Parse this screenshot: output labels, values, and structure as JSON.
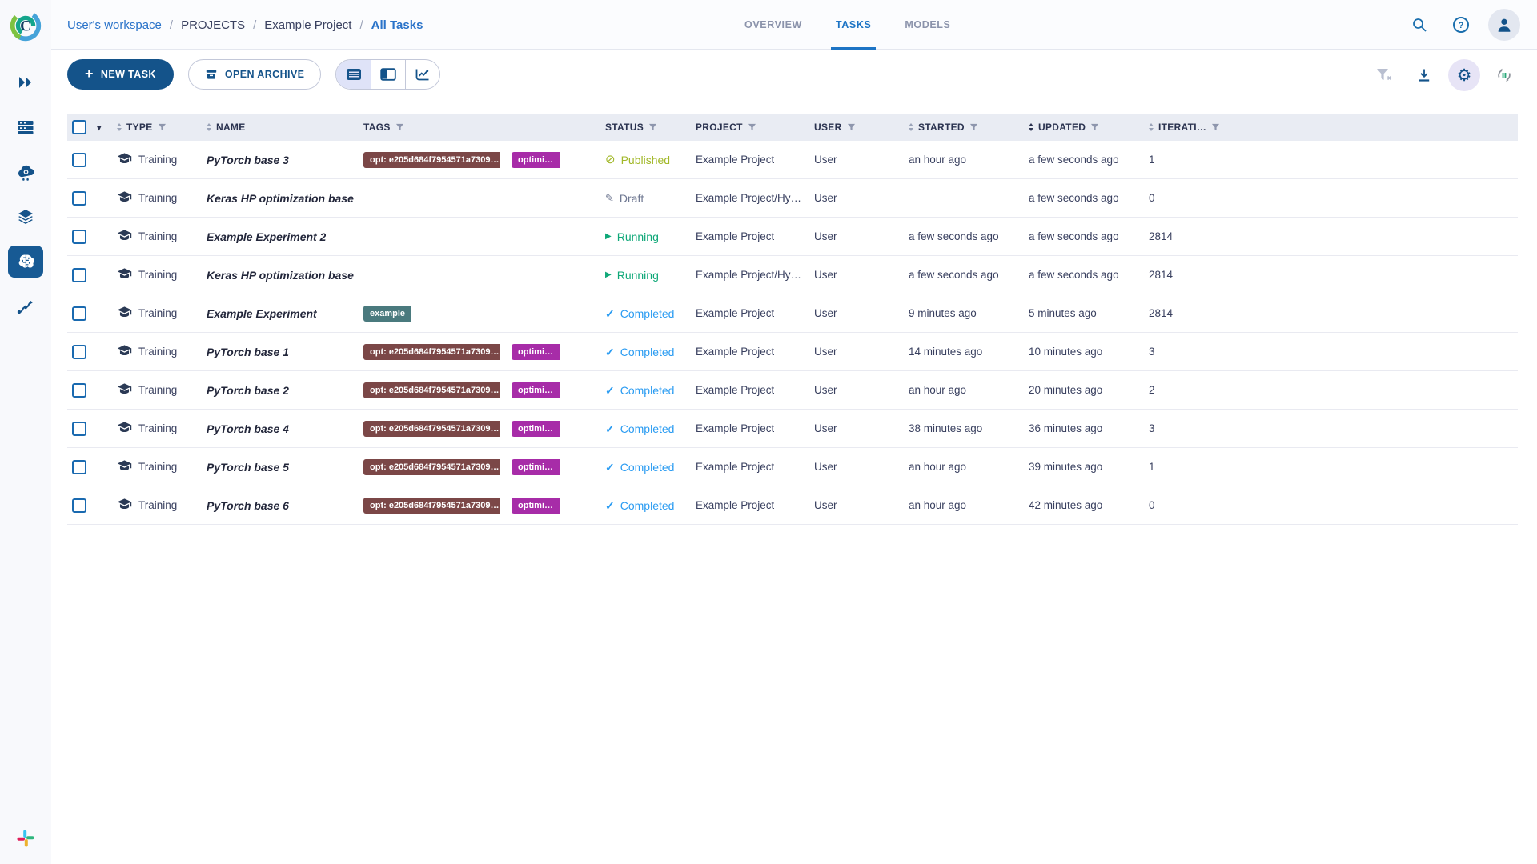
{
  "header": {
    "breadcrumb": [
      {
        "label": "User's workspace"
      },
      {
        "label": "PROJECTS"
      },
      {
        "label": "Example Project"
      },
      {
        "label": "All Tasks"
      }
    ],
    "breadcrumb_separator": "/",
    "tabs": [
      {
        "label": "OVERVIEW",
        "active": false
      },
      {
        "label": "TASKS",
        "active": true
      },
      {
        "label": "MODELS",
        "active": false
      }
    ]
  },
  "toolbar": {
    "new_task_label": "NEW TASK",
    "open_archive_label": "OPEN ARCHIVE"
  },
  "table": {
    "columns": [
      {
        "key": "type",
        "label": "TYPE"
      },
      {
        "key": "name",
        "label": "NAME"
      },
      {
        "key": "tags",
        "label": "TAGS"
      },
      {
        "key": "status",
        "label": "STATUS"
      },
      {
        "key": "project",
        "label": "PROJECT"
      },
      {
        "key": "user",
        "label": "USER"
      },
      {
        "key": "started",
        "label": "STARTED"
      },
      {
        "key": "updated",
        "label": "UPDATED"
      },
      {
        "key": "iterations",
        "label": "ITERATI…"
      }
    ],
    "rows": [
      {
        "type": "Training",
        "name": "PyTorch base 3",
        "tags": [
          {
            "text": "opt: e205d684f7954571a7309…",
            "color": "maroon"
          },
          {
            "text": "optimi…",
            "color": "magenta"
          }
        ],
        "status": {
          "label": "Published",
          "kind": "published"
        },
        "project": "Example Project",
        "user": "User",
        "started": "an hour ago",
        "updated": "a few seconds ago",
        "iterations": "1"
      },
      {
        "type": "Training",
        "name": "Keras HP optimization base",
        "tags": [],
        "status": {
          "label": "Draft",
          "kind": "draft"
        },
        "project": "Example Project/Hy…",
        "user": "User",
        "started": "",
        "updated": "a few seconds ago",
        "iterations": "0"
      },
      {
        "type": "Training",
        "name": "Example Experiment 2",
        "tags": [],
        "status": {
          "label": "Running",
          "kind": "running"
        },
        "project": "Example Project",
        "user": "User",
        "started": "a few seconds ago",
        "updated": "a few seconds ago",
        "iterations": "2814"
      },
      {
        "type": "Training",
        "name": "Keras HP optimization base",
        "tags": [],
        "status": {
          "label": "Running",
          "kind": "running"
        },
        "project": "Example Project/Hy…",
        "user": "User",
        "started": "a few seconds ago",
        "updated": "a few seconds ago",
        "iterations": "2814"
      },
      {
        "type": "Training",
        "name": "Example Experiment",
        "tags": [
          {
            "text": "example",
            "color": "teal"
          }
        ],
        "status": {
          "label": "Completed",
          "kind": "completed"
        },
        "project": "Example Project",
        "user": "User",
        "started": "9 minutes ago",
        "updated": "5 minutes ago",
        "iterations": "2814"
      },
      {
        "type": "Training",
        "name": "PyTorch base 1",
        "tags": [
          {
            "text": "opt: e205d684f7954571a7309…",
            "color": "maroon"
          },
          {
            "text": "optimi…",
            "color": "magenta"
          }
        ],
        "status": {
          "label": "Completed",
          "kind": "completed"
        },
        "project": "Example Project",
        "user": "User",
        "started": "14 minutes ago",
        "updated": "10 minutes ago",
        "iterations": "3"
      },
      {
        "type": "Training",
        "name": "PyTorch base 2",
        "tags": [
          {
            "text": "opt: e205d684f7954571a7309…",
            "color": "maroon"
          },
          {
            "text": "optimi…",
            "color": "magenta"
          }
        ],
        "status": {
          "label": "Completed",
          "kind": "completed"
        },
        "project": "Example Project",
        "user": "User",
        "started": "an hour ago",
        "updated": "20 minutes ago",
        "iterations": "2"
      },
      {
        "type": "Training",
        "name": "PyTorch base 4",
        "tags": [
          {
            "text": "opt: e205d684f7954571a7309…",
            "color": "maroon"
          },
          {
            "text": "optimi…",
            "color": "magenta"
          }
        ],
        "status": {
          "label": "Completed",
          "kind": "completed"
        },
        "project": "Example Project",
        "user": "User",
        "started": "38 minutes ago",
        "updated": "36 minutes ago",
        "iterations": "3"
      },
      {
        "type": "Training",
        "name": "PyTorch base 5",
        "tags": [
          {
            "text": "opt: e205d684f7954571a7309…",
            "color": "maroon"
          },
          {
            "text": "optimi…",
            "color": "magenta"
          }
        ],
        "status": {
          "label": "Completed",
          "kind": "completed"
        },
        "project": "Example Project",
        "user": "User",
        "started": "an hour ago",
        "updated": "39 minutes ago",
        "iterations": "1"
      },
      {
        "type": "Training",
        "name": "PyTorch base 6",
        "tags": [
          {
            "text": "opt: e205d684f7954571a7309…",
            "color": "maroon"
          },
          {
            "text": "optimi…",
            "color": "magenta"
          }
        ],
        "status": {
          "label": "Completed",
          "kind": "completed"
        },
        "project": "Example Project",
        "user": "User",
        "started": "an hour ago",
        "updated": "42 minutes ago",
        "iterations": "0"
      }
    ]
  },
  "status_styles": {
    "published": {
      "glyph": "⊘",
      "color": "#a2b829",
      "icon_name": "published-icon"
    },
    "draft": {
      "glyph": "✎",
      "color": "#6e7791",
      "icon_name": "draft-pencil-icon"
    },
    "running": {
      "glyph": "▶",
      "color": "#0fa878",
      "icon_name": "running-play-icon"
    },
    "completed": {
      "glyph": "✓",
      "color": "#2b9cf2",
      "icon_name": "completed-check-icon"
    }
  },
  "tag_colors": {
    "maroon": "#7b4747",
    "magenta": "#a72ca8",
    "teal": "#4a7a7e"
  },
  "colors": {
    "primary": "#14538a",
    "link": "#2a73c9",
    "tab_active": "#1d74c5",
    "header_bg": "#e9ecf3",
    "active_icon_bg": "#e7e4f6"
  }
}
